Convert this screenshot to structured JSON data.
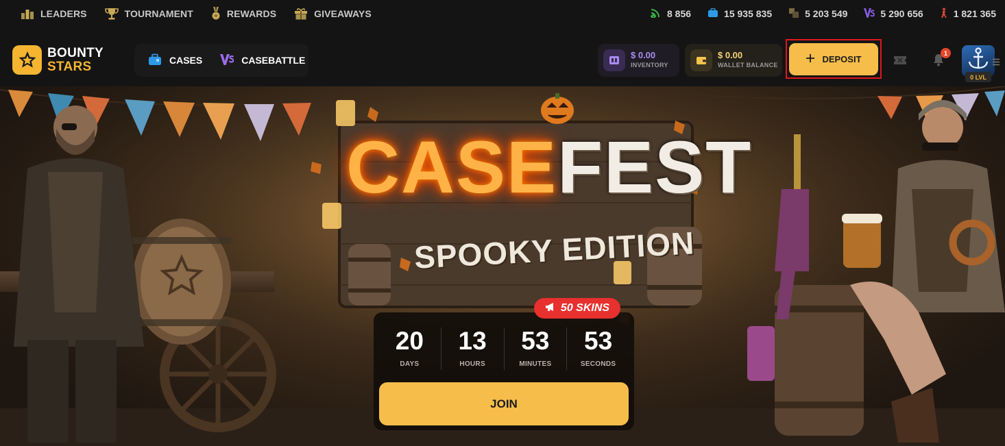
{
  "topnav": {
    "items": [
      {
        "label": "LEADERS",
        "icon": "leaderboard-icon"
      },
      {
        "label": "TOURNAMENT",
        "icon": "trophy-icon"
      },
      {
        "label": "REWARDS",
        "icon": "medal-icon"
      },
      {
        "label": "GIVEAWAYS",
        "icon": "gift-icon"
      }
    ]
  },
  "stats": [
    {
      "icon": "online-signal-icon",
      "value": "8 856",
      "color": "#3bb54a"
    },
    {
      "icon": "case-icon",
      "value": "15 935 835",
      "color": "#2e9ae6"
    },
    {
      "icon": "upgrade-icon",
      "value": "5 203 549",
      "color": "#7a6a40"
    },
    {
      "icon": "casebattle-icon",
      "value": "5 290 656",
      "color": "#8a5ce6"
    },
    {
      "icon": "contract-icon",
      "value": "1 821 365",
      "color": "#d8463a"
    }
  ],
  "logo": {
    "line1": "BOUNTY",
    "line2": "STARS"
  },
  "mainnav": [
    {
      "label": "CASES",
      "icon": "case-icon"
    },
    {
      "label": "CASEBATTLE",
      "icon": "versus-icon"
    }
  ],
  "inventory": {
    "amount": "$ 0.00",
    "label": "INVENTORY"
  },
  "wallet": {
    "amount": "$ 0.00",
    "label": "WALLET BALANCE"
  },
  "deposit": {
    "label": "DEPOSIT"
  },
  "notifications": {
    "count": "1"
  },
  "profile": {
    "level": "0 LVL"
  },
  "banner": {
    "title_part1": "CASE",
    "title_part2": "FEST",
    "subtitle": "SPOOKY EDITION",
    "badge": "50 SKINS",
    "timer": [
      {
        "value": "20",
        "unit": "DAYS"
      },
      {
        "value": "13",
        "unit": "HOURS"
      },
      {
        "value": "53",
        "unit": "MINUTES"
      },
      {
        "value": "53",
        "unit": "SECONDS"
      }
    ],
    "join_label": "JOIN"
  },
  "colors": {
    "accent": "#f7bd4a",
    "background": "#141414",
    "highlight_outline": "#e0161d"
  }
}
